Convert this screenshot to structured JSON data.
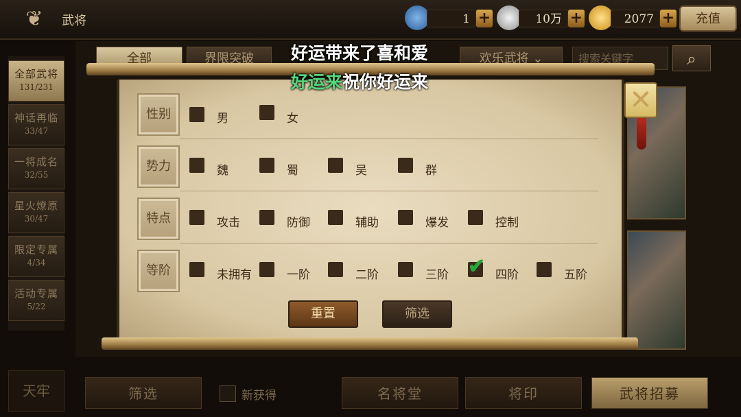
{
  "header": {
    "title": "武将",
    "resources": [
      {
        "name": "crystal",
        "value": "1"
      },
      {
        "name": "silver",
        "value": "10万"
      },
      {
        "name": "gold",
        "value": "2077"
      }
    ],
    "recharge_label": "充值"
  },
  "sidebar": {
    "items": [
      {
        "label": "全部武将",
        "count": "131/231",
        "active": true
      },
      {
        "label": "神话再临",
        "count": "33/47"
      },
      {
        "label": "一将成名",
        "count": "32/55"
      },
      {
        "label": "星火燎原",
        "count": "30/47"
      },
      {
        "label": "限定专属",
        "count": "4/34"
      },
      {
        "label": "活动专属",
        "count": "5/22"
      }
    ]
  },
  "tabs": [
    {
      "label": "全部",
      "active": true
    },
    {
      "label": "界限突破"
    },
    {
      "label": "欢乐武将"
    }
  ],
  "search": {
    "placeholder": "搜索关键字"
  },
  "filter": {
    "rows": [
      {
        "label": "性别",
        "options": [
          {
            "label": "男",
            "checked": false
          },
          {
            "label": "女",
            "checked": false
          }
        ]
      },
      {
        "label": "势力",
        "options": [
          {
            "label": "魏",
            "checked": false
          },
          {
            "label": "蜀",
            "checked": false
          },
          {
            "label": "吴",
            "checked": false
          },
          {
            "label": "群",
            "checked": false
          }
        ]
      },
      {
        "label": "特点",
        "options": [
          {
            "label": "攻击",
            "checked": false
          },
          {
            "label": "防御",
            "checked": false
          },
          {
            "label": "辅助",
            "checked": false
          },
          {
            "label": "爆发",
            "checked": false
          },
          {
            "label": "控制",
            "checked": false
          }
        ]
      },
      {
        "label": "等阶",
        "options": [
          {
            "label": "未拥有",
            "checked": false
          },
          {
            "label": "一阶",
            "checked": false
          },
          {
            "label": "二阶",
            "checked": false
          },
          {
            "label": "三阶",
            "checked": false
          },
          {
            "label": "四阶",
            "checked": true
          },
          {
            "label": "五阶",
            "checked": false
          }
        ]
      }
    ],
    "reset_label": "重置",
    "apply_label": "筛选",
    "close_icon": "close-x-icon"
  },
  "bottom": {
    "tianlao_label": "天牢",
    "filter_label": "筛选",
    "new_label": "新获得",
    "hall_label": "名将堂",
    "seal_label": "将印",
    "recruit_label": "武将招募"
  },
  "caption": {
    "line1": "好运带来了喜和爱",
    "line2_highlight": "好运来",
    "line2_rest": "祝你好运来"
  }
}
